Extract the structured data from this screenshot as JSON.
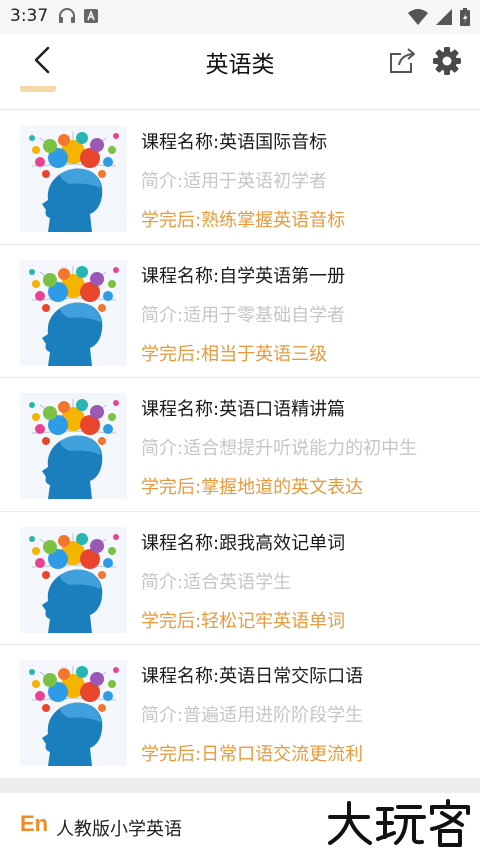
{
  "status_bar": {
    "time": "3:37",
    "left_icons": [
      "headphones-icon",
      "text-a-icon"
    ],
    "right_icons": [
      "wifi-icon",
      "signal-icon",
      "battery-icon"
    ]
  },
  "header": {
    "title": "英语类",
    "back_icon": "chevron-left-icon",
    "share_icon": "share-icon",
    "settings_icon": "gear-icon"
  },
  "courses": [
    {
      "name": "课程名称:英语国际音标",
      "intro": "简介:适用于英语初学者",
      "result": "学完后:熟练掌握英语音标"
    },
    {
      "name": "课程名称:自学英语第一册",
      "intro": "简介:适用于零基础自学者",
      "result": "学完后:相当于英语三级"
    },
    {
      "name": "课程名称:英语口语精讲篇",
      "intro": "简介:适合想提升听说能力的初中生",
      "result": "学完后:掌握地道的英文表达"
    },
    {
      "name": "课程名称:跟我高效记单词",
      "intro": "简介:适合英语学生",
      "result": "学完后:轻松记牢英语单词"
    },
    {
      "name": "课程名称:英语日常交际口语",
      "intro": "简介:普遍适用进阶阶段学生",
      "result": "学完后:日常口语交流更流利"
    }
  ],
  "ad": {
    "logo": "En",
    "text": "人教版小学英语"
  },
  "watermark": "大玩客",
  "colors": {
    "accent": "#e89a3c",
    "muted": "#c6c6c6",
    "title": "#1a1a1a"
  }
}
